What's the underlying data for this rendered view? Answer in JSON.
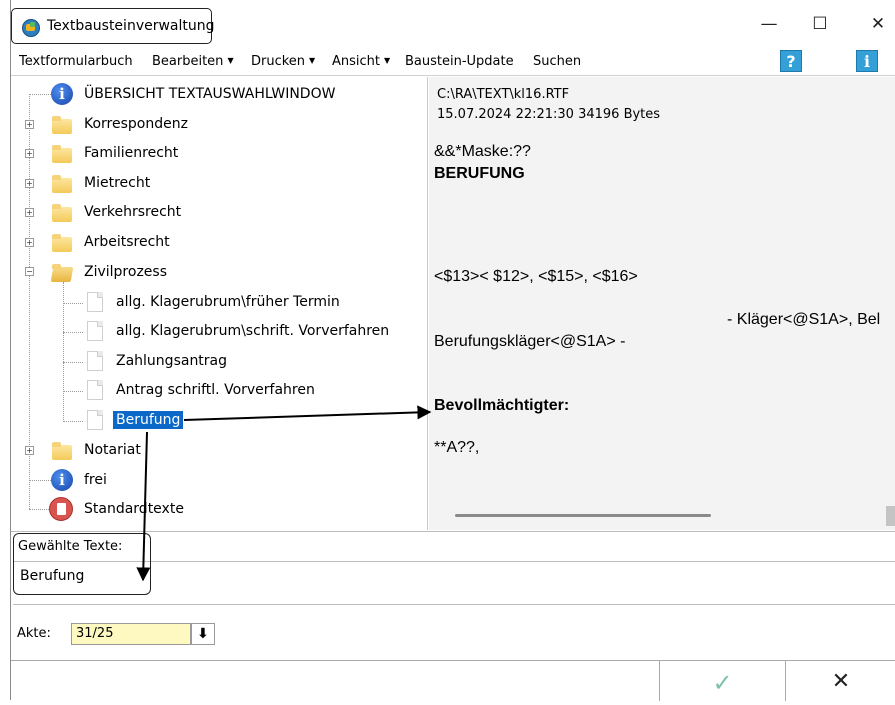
{
  "window": {
    "title": "Textbausteinverwaltung",
    "controls": {
      "minimize": "—",
      "maximize": "☐",
      "close": "✕"
    }
  },
  "menu": {
    "items": [
      {
        "label": "Textformularbuch",
        "dropdown": ""
      },
      {
        "label": "Bearbeiten",
        "dropdown": "▼"
      },
      {
        "label": "Drucken",
        "dropdown": "▼"
      },
      {
        "label": "Ansicht",
        "dropdown": "▼"
      },
      {
        "label": "Baustein-Update",
        "dropdown": ""
      },
      {
        "label": "Suchen",
        "dropdown": ""
      }
    ],
    "help_glyph": "?",
    "info_glyph": "i"
  },
  "tree": {
    "root": {
      "label": "ÜBERSICHT TEXTAUSWAHLWINDOW",
      "icon": "info-icon"
    },
    "folders": [
      {
        "label": "Korrespondenz",
        "expand": "+"
      },
      {
        "label": "Familienrecht",
        "expand": "+"
      },
      {
        "label": "Mietrecht",
        "expand": "+"
      },
      {
        "label": "Verkehrsrecht",
        "expand": "+"
      },
      {
        "label": "Arbeitsrecht",
        "expand": "+"
      },
      {
        "label": "Zivilprozess",
        "expand": "−"
      }
    ],
    "children": [
      {
        "label": "allg. Klagerubrum\\früher Termin"
      },
      {
        "label": "allg. Klagerubrum\\schrift. Vorverfahren"
      },
      {
        "label": "Zahlungsantrag"
      },
      {
        "label": "Antrag schriftl. Vorverfahren"
      },
      {
        "label": "Berufung",
        "selected": true
      }
    ],
    "after": [
      {
        "label": "Notariat",
        "expand": "+"
      },
      {
        "label": "frei",
        "icon": "info-icon"
      },
      {
        "label": "Standardtexte",
        "icon": "standard-texts-icon"
      }
    ],
    "info_glyph": "i"
  },
  "preview": {
    "path": "C:\\RA\\TEXT\\kl16.RTF",
    "meta": "15.07.2024 22:21:30  34196 Bytes",
    "lines": {
      "mask": "&&*Maske:??",
      "heading": "BERUFUNG",
      "fields": "<$13>< $12>, <$15>, <$16>",
      "klaeger": "- Kläger<@S1A>, Bel",
      "berufungsklaeger": "Berufungskläger<@S1A> -",
      "bevollmaechtigter": "Bevollmächtigter:",
      "attorney": "**A??,"
    }
  },
  "selection": {
    "label": "Gewählte Texte:",
    "value": "Berufung"
  },
  "akte": {
    "label": "Akte:",
    "value": "31/25",
    "dropdown_glyph": "⬇"
  },
  "footer": {
    "ok_glyph": "✓",
    "cancel_glyph": "✕"
  }
}
